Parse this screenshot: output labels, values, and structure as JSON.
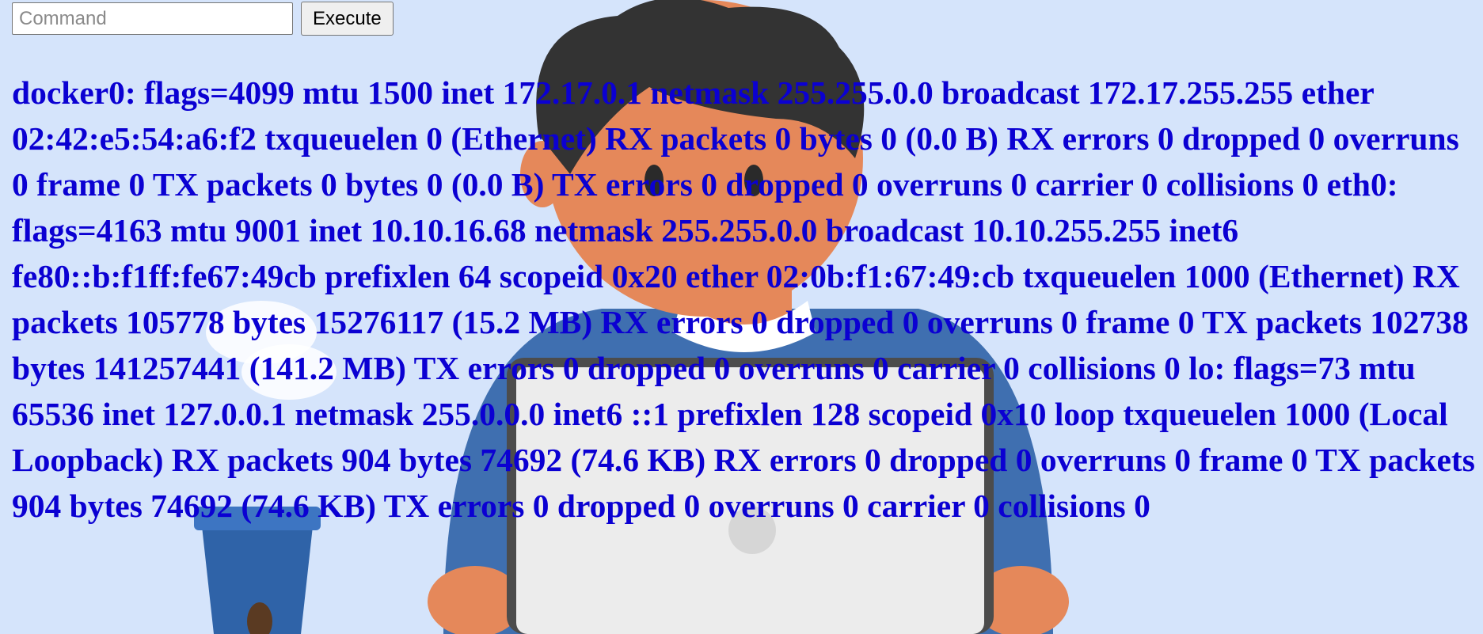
{
  "command": {
    "placeholder": "Command",
    "value": "",
    "execute_label": "Execute"
  },
  "output": {
    "text": "docker0: flags=4099 mtu 1500 inet 172.17.0.1 netmask 255.255.0.0 broadcast 172.17.255.255 ether 02:42:e5:54:a6:f2 txqueuelen 0 (Ethernet) RX packets 0 bytes 0 (0.0 B) RX errors 0 dropped 0 overruns 0 frame 0 TX packets 0 bytes 0 (0.0 B) TX errors 0 dropped 0 overruns 0 carrier 0 collisions 0 eth0: flags=4163 mtu 9001 inet 10.10.16.68 netmask 255.255.0.0 broadcast 10.10.255.255 inet6 fe80::b:f1ff:fe67:49cb prefixlen 64 scopeid 0x20 ether 02:0b:f1:67:49:cb txqueuelen 1000 (Ethernet) RX packets 105778 bytes 15276117 (15.2 MB) RX errors 0 dropped 0 overruns 0 frame 0 TX packets 102738 bytes 141257441 (141.2 MB) TX errors 0 dropped 0 overruns 0 carrier 0 collisions 0 lo: flags=73 mtu 65536 inet 127.0.0.1 netmask 255.0.0.0 inet6 ::1 prefixlen 128 scopeid 0x10 loop txqueuelen 1000 (Local Loopback) RX packets 904 bytes 74692 (74.6 KB) RX errors 0 dropped 0 overruns 0 frame 0 TX packets 904 bytes 74692 (74.6 KB) TX errors 0 dropped 0 overruns 0 carrier 0 collisions 0"
  },
  "colors": {
    "background": "#d5e4fb",
    "output_text": "#0b00d2"
  },
  "background_image": {
    "icon": "person-with-laptop-and-coffee-illustration"
  }
}
